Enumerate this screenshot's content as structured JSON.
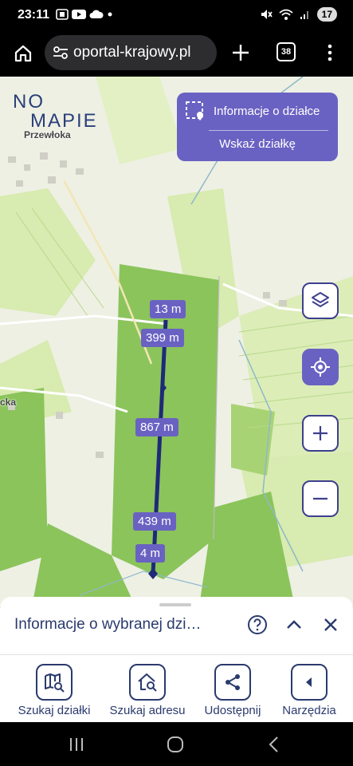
{
  "status_bar": {
    "time": "23:11",
    "battery": "17",
    "left_icons": [
      "screenshot-icon",
      "youtube-icon",
      "cloud-icon",
      "dot-icon"
    ],
    "right_icons": [
      "mute-icon",
      "wifi-icon",
      "signal-icon",
      "battery-icon"
    ]
  },
  "browser": {
    "url": "oportal-krajowy.pl",
    "tab_count": "38"
  },
  "map": {
    "logo_line1": "NO",
    "logo_line2": "MAPIE",
    "place_labels": [
      "Przewłoka",
      "cka"
    ],
    "parcel_panel": {
      "info_label": "Informacje o działce",
      "select_label": "Wskaż działkę"
    },
    "measure_labels": [
      "13 m",
      "399 m",
      "867 m",
      "439 m",
      "4 m"
    ],
    "controls": [
      "layers-icon",
      "locate-icon",
      "zoom-in-icon",
      "zoom-out-icon"
    ]
  },
  "sheet": {
    "title": "Informacje o wybranej dzi…",
    "tools": [
      {
        "label": "Szukaj działki",
        "icon": "map-search-icon"
      },
      {
        "label": "Szukaj adresu",
        "icon": "home-search-icon"
      },
      {
        "label": "Udostępnij",
        "icon": "share-icon"
      },
      {
        "label": "Narzędzia",
        "icon": "tools-arrow-icon"
      }
    ]
  },
  "colors": {
    "accent": "#6a62c2",
    "navy": "#2a3a6e",
    "forest": "#8bc45b",
    "meadow": "#d8ebb0"
  }
}
